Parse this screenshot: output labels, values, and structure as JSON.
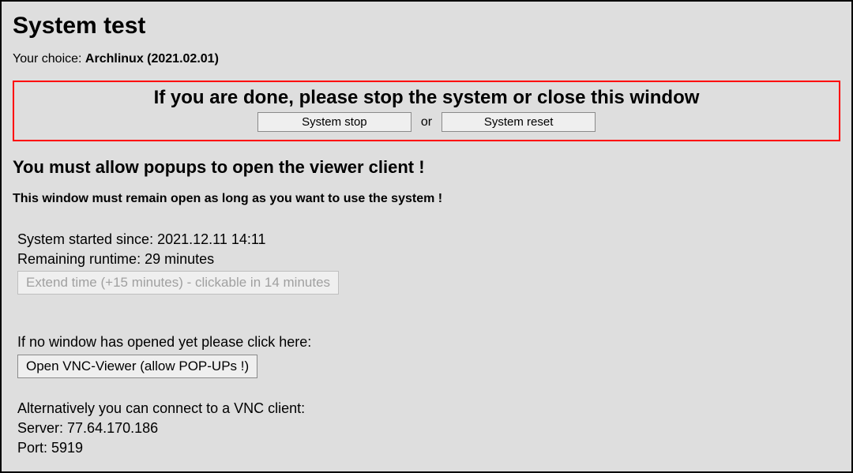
{
  "title": "System test",
  "choice": {
    "label": "Your choice: ",
    "value": "Archlinux (2021.02.01)"
  },
  "stop_box": {
    "heading": "If you are done, please stop the system or close this window",
    "stop_button": "System stop",
    "or_text": "or",
    "reset_button": "System reset"
  },
  "popup_heading": "You must allow popups to open the viewer client !",
  "remain_open_warning": "This window must remain open as long as you want to use the system !",
  "status": {
    "started_label": "System started since: ",
    "started_value": "2021.12.11 14:11",
    "remaining_label": "Remaining runtime: ",
    "remaining_value": "29 minutes",
    "extend_button": "Extend time (+15 minutes) - clickable in 14 minutes"
  },
  "vnc": {
    "no_window_text": "If no window has opened yet please click here:",
    "open_button": "Open VNC-Viewer (allow POP-UPs !)",
    "alt_text": "Alternatively you can connect to a VNC client:",
    "server_label": "Server: ",
    "server_value": "77.64.170.186",
    "port_label": "Port: ",
    "port_value": "5919"
  }
}
